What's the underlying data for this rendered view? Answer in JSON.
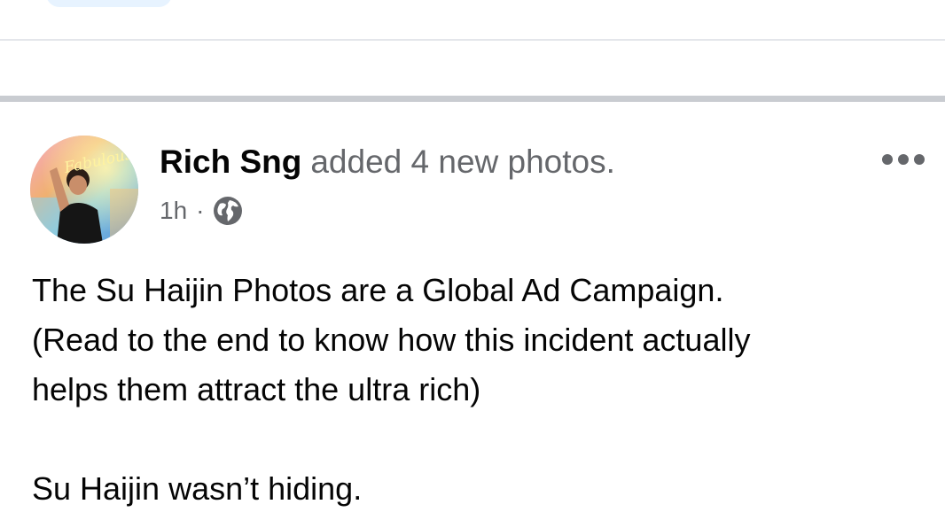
{
  "top": {
    "pill_visible": true
  },
  "post": {
    "author_name": "Rich Sng",
    "action_text": "added 4 new photos.",
    "timestamp": "1h",
    "separator": "·",
    "privacy_icon": "globe-icon",
    "more_icon": "more-options-icon",
    "avatar_neon_text": "Fabulous",
    "body_lines": [
      "The Su Haijin Photos are a Global Ad Campaign.",
      "(Read to the end to know how this incident actually",
      "helps them attract the ultra rich)"
    ],
    "body_second_paragraph": "Su Haijin wasn’t hiding."
  },
  "colors": {
    "name": "#050505",
    "secondary_text": "#65676b",
    "divider_thin": "#e4e6eb",
    "divider_thick": "#c9ccd1",
    "pill": "#e7f3ff"
  }
}
